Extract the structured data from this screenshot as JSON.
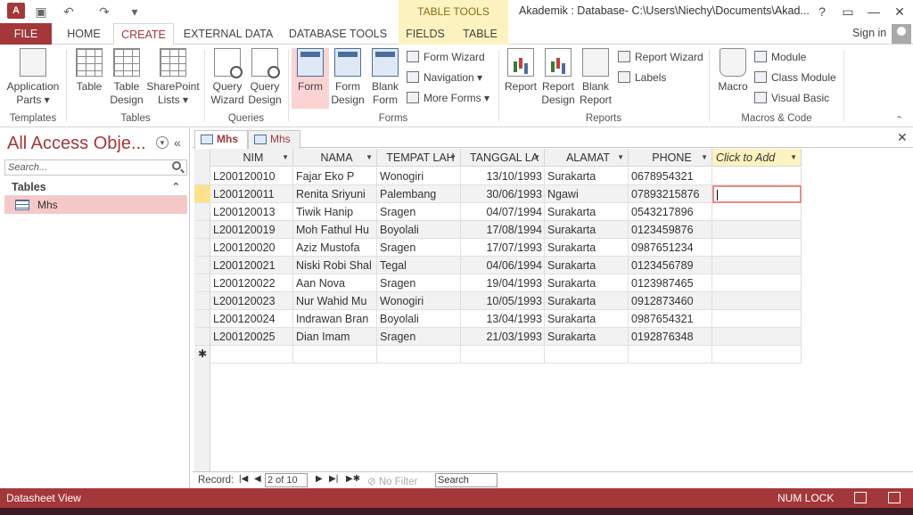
{
  "titlebar": {
    "app_badge": "A",
    "tool_header": "TABLE TOOLS",
    "title": "Akademik : Database- C:\\Users\\Niechy\\Documents\\Akad...",
    "controls": {
      "help": "?",
      "restore": "❐",
      "close": "✕",
      "minimize": "—",
      "maximize": "❐"
    }
  },
  "tabs": [
    "FILE",
    "HOME",
    "CREATE",
    "EXTERNAL DATA",
    "DATABASE TOOLS",
    "FIELDS",
    "TABLE"
  ],
  "signin": "Sign in",
  "ribbon": {
    "templates": {
      "app_parts": "Application",
      "app_parts2": "Parts ▾",
      "label": "Templates"
    },
    "tables": {
      "table": "Table",
      "table_design": "Table",
      "table_design2": "Design",
      "sharepoint": "SharePoint",
      "sharepoint2": "Lists ▾",
      "label": "Tables"
    },
    "queries": {
      "wizard": "Query",
      "wizard2": "Wizard",
      "design": "Query",
      "design2": "Design",
      "label": "Queries"
    },
    "forms": {
      "form": "Form",
      "form_design": "Form",
      "form_design2": "Design",
      "blank_form": "Blank",
      "blank_form2": "Form",
      "form_wizard": "Form Wizard",
      "navigation": "Navigation ▾",
      "more_forms": "More Forms ▾",
      "label": "Forms"
    },
    "reports": {
      "report": "Report",
      "report_design": "Report",
      "report_design2": "Design",
      "blank_report": "Blank",
      "blank_report2": "Report",
      "report_wizard": "Report Wizard",
      "labels": "Labels",
      "label": "Reports"
    },
    "macros": {
      "macro": "Macro",
      "module": "Module",
      "class_module": "Class Module",
      "visual_basic": "Visual Basic",
      "label": "Macros & Code"
    }
  },
  "nav": {
    "title": "All Access Obje...",
    "search_placeholder": "Search...",
    "group": "Tables",
    "item": "Mhs"
  },
  "doc_tabs": [
    "Mhs",
    "Mhs"
  ],
  "grid": {
    "headers": [
      "NIM",
      "NAMA",
      "TEMPAT LAH",
      "TANGGAL LA",
      "ALAMAT",
      "PHONE",
      "Click to Add"
    ],
    "rows": [
      [
        "L200120010",
        "Fajar Eko P",
        "Wonogiri",
        "13/10/1993",
        "Surakarta",
        "0678954321"
      ],
      [
        "L200120011",
        "Renita Sriyuni",
        "Palembang",
        "30/06/1993",
        "Ngawi",
        "07893215876"
      ],
      [
        "L200120013",
        "Tiwik Hanip",
        "Sragen",
        "04/07/1994",
        "Surakarta",
        "0543217896"
      ],
      [
        "L200120019",
        "Moh Fathul Hu",
        "Boyolali",
        "17/08/1994",
        "Surakarta",
        "0123459876"
      ],
      [
        "L200120020",
        "Aziz Mustofa",
        "Sragen",
        "17/07/1993",
        "Surakarta",
        "0987651234"
      ],
      [
        "L200120021",
        "Niski Robi Shal",
        "Tegal",
        "04/06/1994",
        "Surakarta",
        "0123456789"
      ],
      [
        "L200120022",
        "Aan Nova",
        "Sragen",
        "19/04/1993",
        "Surakarta",
        "0123987465"
      ],
      [
        "L200120023",
        "Nur Wahid Mu",
        "Wonogiri",
        "10/05/1993",
        "Surakarta",
        "0912873460"
      ],
      [
        "L200120024",
        "Indrawan Bran",
        "Boyolali",
        "13/04/1993",
        "Surakarta",
        "0987654321"
      ],
      [
        "L200120025",
        "Dian Imam",
        "Sragen",
        "21/03/1993",
        "Surakarta",
        "0192876348"
      ]
    ],
    "new_row_marker": "✱"
  },
  "recnav": {
    "label": "Record:",
    "position": "2 of 10",
    "filter": "No Filter",
    "search": "Search"
  },
  "status": {
    "left": "Datasheet View",
    "numlock": "NUM LOCK"
  },
  "colors": {
    "accent": "#a4373a",
    "tooltab": "#fdf3c0",
    "current_row": "#fde28c"
  }
}
